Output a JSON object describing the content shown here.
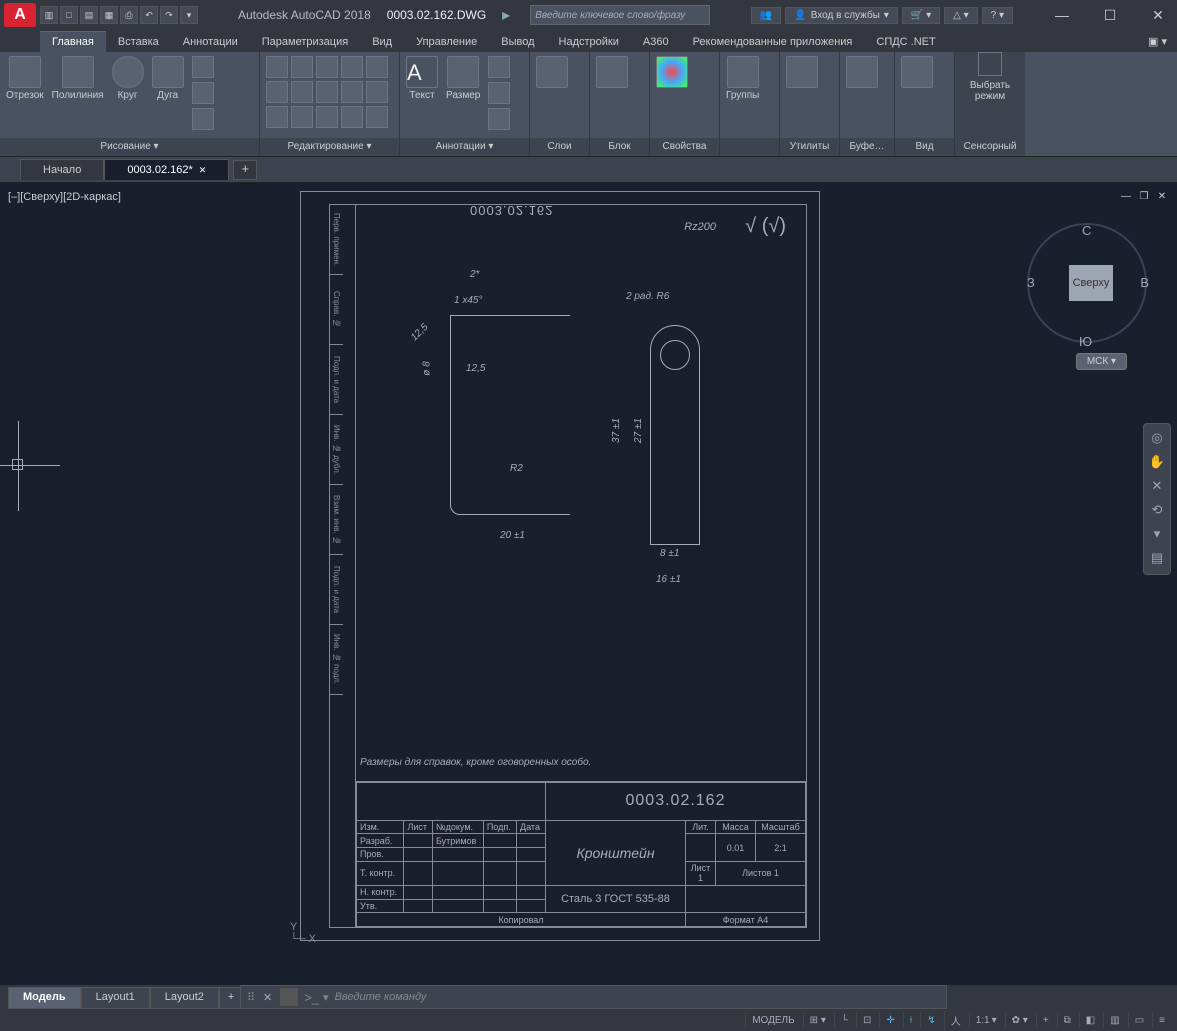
{
  "title": {
    "app": "Autodesk AutoCAD 2018",
    "file": "0003.02.162.DWG"
  },
  "search": {
    "placeholder": "Введите ключевое слово/фразу"
  },
  "signin": "Вход в службы",
  "tabs": [
    "Главная",
    "Вставка",
    "Аннотации",
    "Параметризация",
    "Вид",
    "Управление",
    "Вывод",
    "Надстройки",
    "A360",
    "Рекомендованные приложения",
    "СПДС .NET"
  ],
  "ribbon": {
    "draw": {
      "title": "Рисование ▾",
      "items": [
        "Отрезок",
        "Полилиния",
        "Круг",
        "Дуга"
      ]
    },
    "edit": {
      "title": "Редактирование ▾"
    },
    "annot": {
      "title": "Аннотации ▾",
      "text": "Текст",
      "dim": "Размер"
    },
    "layers": "Слои",
    "block": "Блок",
    "props": "Свойства",
    "groups": "Группы",
    "utils": "Утилиты",
    "clip": "Буфе…",
    "view": "Вид",
    "sensory": {
      "l1": "Выбрать",
      "l2": "режим",
      "title": "Сенсорный"
    }
  },
  "docTabs": {
    "home": "Начало",
    "active": "0003.02.162*"
  },
  "viewport": {
    "label": "[–][Сверху][2D-каркас]"
  },
  "viewcube": {
    "face": "Сверху",
    "n": "С",
    "s": "Ю",
    "e": "В",
    "w": "З",
    "mck": "МСК ▾"
  },
  "drawing": {
    "mirrorNum": "0003.02.162",
    "rz": "Rz200",
    "note": "Размеры для справок, кроме оговоренных особо.",
    "dims": {
      "twoStar": "2*",
      "cham": "1 x45°",
      "r2": "R2",
      "w20": "20 ±1",
      "d8": "ø 8",
      "t125": "12,5",
      "ang": "12,5",
      "rad": "2 рад. R6",
      "h37": "37 ±1",
      "h27": "27 ±1",
      "w8": "8 ±1",
      "w16": "16 ±1"
    },
    "titleBlock": {
      "num": "0003.02.162",
      "name": "Кронштейн",
      "material": "Сталь 3 ГОСТ 535-88",
      "hdr": {
        "izm": "Изм.",
        "list": "Лист",
        "ndoc": "№докум.",
        "podp": "Подп.",
        "data": "Дата"
      },
      "rows": {
        "razrab": "Разраб.",
        "bytr": "Бутримов",
        "prov": "Пров.",
        "tkontr": "Т. контр.",
        "nkontr": "Н. контр.",
        "utv": "Утв."
      },
      "right": {
        "lit": "Лит.",
        "massa": "Масса",
        "masht": "Масштаб",
        "massaVal": "0.01",
        "mashtVal": "2:1",
        "list": "Лист 1",
        "listov": "Листов 1",
        "kopir": "Копировал",
        "fmt": "Формат А4"
      }
    },
    "sideCol": [
      "Перв. примен.",
      "Справ. №",
      "Подп. и дата",
      "Инв. № дубл.",
      "Взам. инв. №",
      "Подп. и дата",
      "Инв. № подл."
    ]
  },
  "cmd": {
    "prompt": ">_",
    "placeholder": "Введите команду"
  },
  "layoutTabs": [
    "Модель",
    "Layout1",
    "Layout2"
  ],
  "status": {
    "model": "МОДЕЛЬ",
    "scale": "1:1"
  }
}
